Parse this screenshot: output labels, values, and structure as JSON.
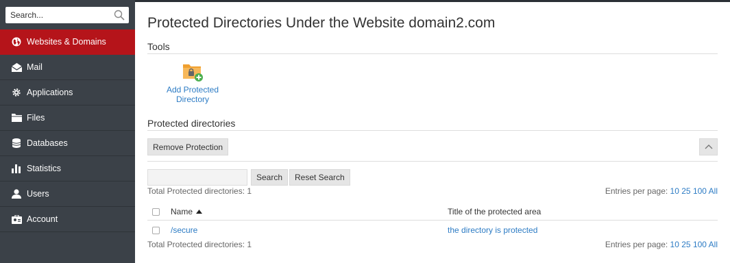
{
  "sidebar": {
    "search_placeholder": "Search...",
    "items": [
      {
        "label": "Websites & Domains",
        "icon": "globe-icon",
        "active": true
      },
      {
        "label": "Mail",
        "icon": "mail-icon"
      },
      {
        "label": "Applications",
        "icon": "gear-icon"
      },
      {
        "label": "Files",
        "icon": "folder-icon"
      },
      {
        "label": "Databases",
        "icon": "database-icon"
      },
      {
        "label": "Statistics",
        "icon": "bar-chart-icon"
      },
      {
        "label": "Users",
        "icon": "user-icon"
      },
      {
        "label": "Account",
        "icon": "account-icon"
      }
    ]
  },
  "main": {
    "title": "Protected Directories Under the Website domain2.com",
    "tools_heading": "Tools",
    "tool_add_label": "Add Protected Directory",
    "list_heading": "Protected directories",
    "remove_button": "Remove Protection",
    "search_button": "Search",
    "reset_button": "Reset Search",
    "total_text": "Total Protected directories: 1",
    "entries_label": "Entries per page:",
    "entries_options": [
      "10",
      "25",
      "100",
      "All"
    ],
    "table": {
      "columns": [
        "Name",
        "Title of the protected area"
      ],
      "rows": [
        {
          "name": "/secure",
          "title": "the directory is protected"
        }
      ]
    }
  },
  "colors": {
    "sidebar_bg": "#3b4148",
    "active_item": "#b5141a",
    "link": "#2c7bc4"
  }
}
